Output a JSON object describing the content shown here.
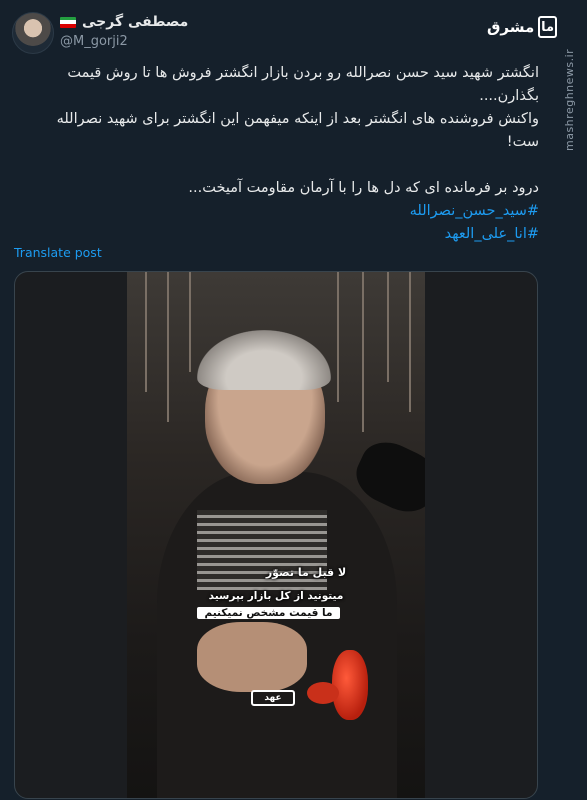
{
  "author": {
    "display_name": "مصطفی گرجی",
    "handle": "@M_gorji2",
    "flag_colors": [
      "#239f40",
      "#ffffff",
      "#da0000"
    ]
  },
  "watermark": {
    "logo_box": "ما",
    "logo_text": "مشرق",
    "side_text": "mashreghnews.ir"
  },
  "post": {
    "line1": "انگشتر شهید سید حسن نصرالله رو بردن بازار انگشتر فروش ها تا روش قیمت بگذارن....",
    "line2": "واکنش فروشنده های انگشتر بعد از اینکه میفهمن این انگشتر برای شهید نصرالله ست!",
    "line3": "درود بر فرمانده ای که دل ها را با آرمان مقاومت آمیخت...",
    "hashtags": [
      "#سید_حسن_نصرالله",
      "#انا_علی_العهد"
    ]
  },
  "translate_label": "Translate post",
  "video": {
    "caption_title": "لا قبل ما تصوّر",
    "caption_line1": "میتونید از کل بازار بپرسید",
    "caption_line2": "ما قیمت مشخص نمیکنیم",
    "logo": "ﻋﻬﺪ"
  }
}
